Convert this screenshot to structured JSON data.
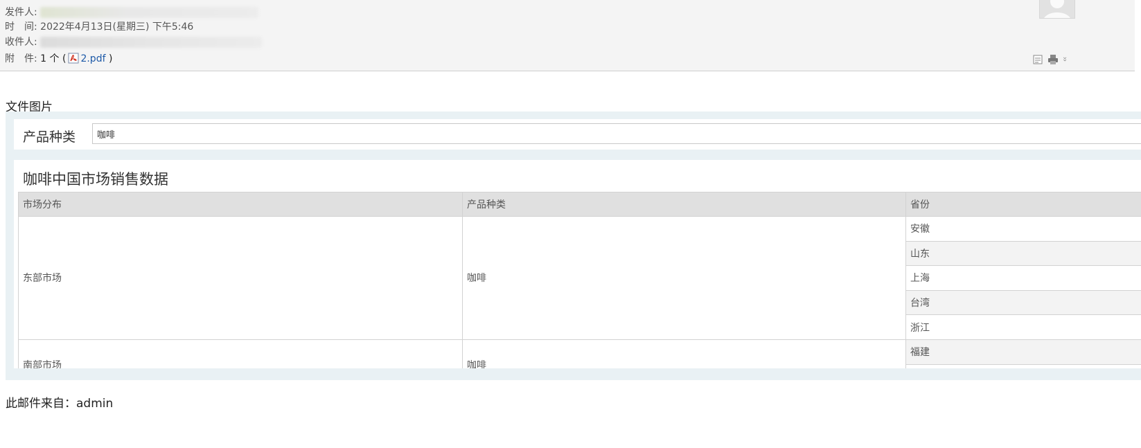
{
  "header": {
    "sender_label": "发件人:",
    "time_label": "时　间:",
    "time_value": "2022年4月13日(星期三) 下午5:46",
    "recipient_label": "收件人:",
    "attachment_label": "附　件:",
    "attachment_count": "1 个 (",
    "attachment_name": "2.pdf",
    "attachment_close": ")"
  },
  "section_title": "文件图片",
  "filter": {
    "label": "产品种类",
    "value": "咖啡"
  },
  "report": {
    "title": "咖啡中国市场销售数据",
    "columns": [
      "市场分布",
      "产品种类",
      "省份"
    ],
    "groups": [
      {
        "market": "东部市场",
        "product": "咖啡",
        "provinces": [
          "安徽",
          "山东",
          "上海",
          "台湾",
          "浙江"
        ]
      },
      {
        "market": "南部市场",
        "product": "咖啡",
        "provinces": [
          "福建"
        ]
      }
    ]
  },
  "footer_text": "此邮件来自：admin",
  "icons": [
    "avatar",
    "pdf-icon",
    "note-icon",
    "print-icon",
    "chevron-down-icon"
  ],
  "colors": {
    "link": "#1e5aa8",
    "header_bg": "#f4f4f4",
    "panel_bg": "#e9f1f4",
    "table_header_bg": "#e0e0e0"
  }
}
